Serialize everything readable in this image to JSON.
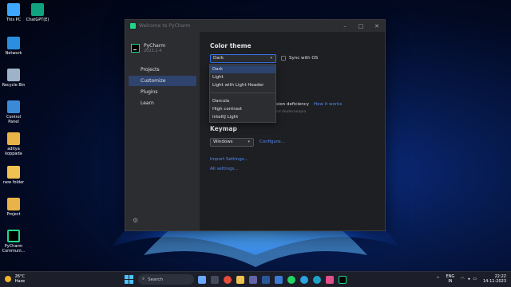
{
  "desktop": {
    "icons": [
      {
        "label": "This PC"
      },
      {
        "label": "ChatGPT(E)"
      },
      {
        "label": "Network"
      },
      {
        "label": "Recycle Bin"
      },
      {
        "label": "Control Panel"
      },
      {
        "label": "aditya koppada"
      },
      {
        "label": "new folder"
      },
      {
        "label": "Project"
      },
      {
        "label": "PyCharm Communi..."
      }
    ]
  },
  "window": {
    "title": "Welcome to PyCharm",
    "controls": {
      "minimize": "–",
      "maximize": "□",
      "close": "✕"
    }
  },
  "sidebar": {
    "product_name": "PyCharm",
    "product_version": "2023.2.4",
    "items": [
      {
        "label": "Projects"
      },
      {
        "label": "Customize"
      },
      {
        "label": "Plugins"
      },
      {
        "label": "Learn"
      }
    ],
    "active_index": 1,
    "settings_icon": "gear-icon"
  },
  "main": {
    "color_theme_heading": "Color theme",
    "theme_selected": "Dark",
    "sync_os_label": "Sync with OS",
    "vision_label": "sion deficiency",
    "vision_link": "How it works",
    "vision_hint": "ed deuteranopia",
    "keymap_heading": "Keymap",
    "keymap_selected": "Windows",
    "configure_link": "Configure...",
    "import_link": "Import Settings...",
    "all_settings_link": "All settings..."
  },
  "theme_dropdown": {
    "options_group1": [
      "Dark",
      "Light",
      "Light with Light Header"
    ],
    "options_group2": [
      "Darcula",
      "High contrast",
      "IntelliJ Light"
    ]
  },
  "taskbar": {
    "weather_temp": "26°C",
    "weather_desc": "Haze",
    "search_label": "Search",
    "lang_top": "ENG",
    "lang_bottom": "IN",
    "time": "22:22",
    "date": "14-11-2023"
  },
  "colors": {
    "accent": "#3574f0",
    "selection": "#2e436e",
    "link": "#548af7",
    "pycharm_green": "#21d789"
  }
}
